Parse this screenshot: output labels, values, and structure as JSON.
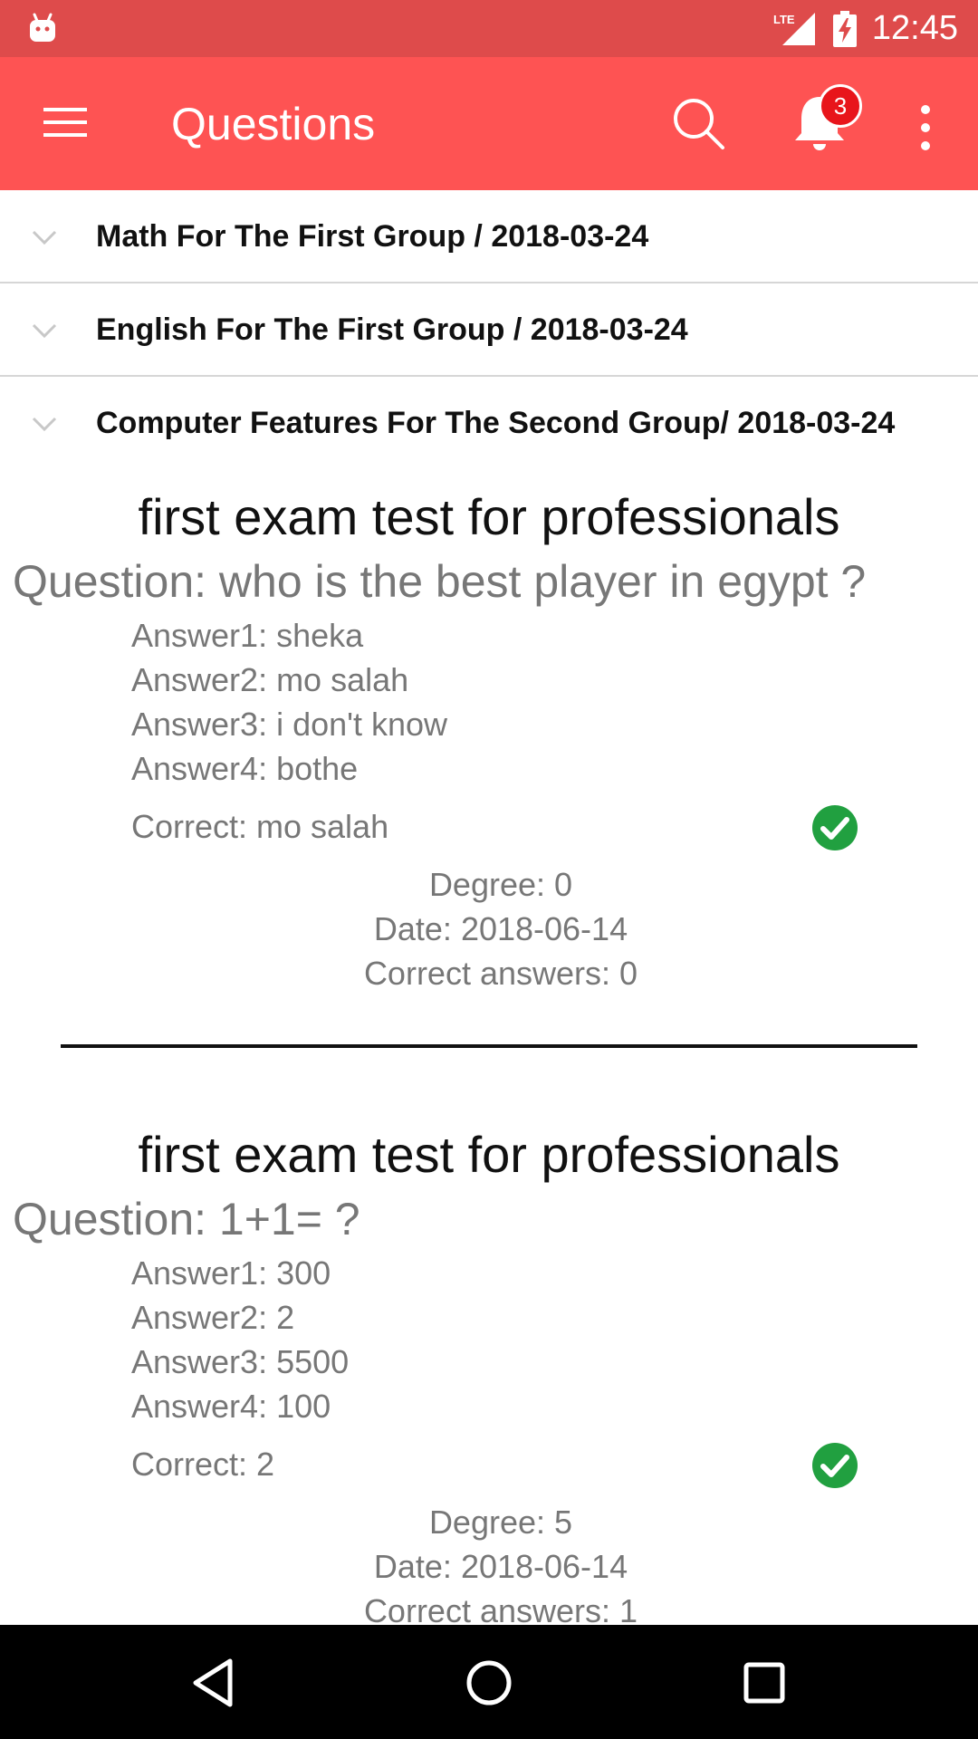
{
  "status_bar": {
    "time": "12:45",
    "network": "LTE",
    "icons": [
      "android-icon",
      "lte-signal-icon",
      "battery-charging-icon"
    ]
  },
  "app_bar": {
    "title": "Questions",
    "notification_count": "3",
    "icons": [
      "menu-icon",
      "search-icon",
      "bell-icon",
      "more-vert-icon"
    ],
    "color": "#fe5353"
  },
  "groups": [
    {
      "label": "Math For The First Group / 2018-03-24"
    },
    {
      "label": "English For The First Group / 2018-03-24"
    },
    {
      "label": "Computer Features For The Second Group/ 2018-03-24"
    }
  ],
  "questions": [
    {
      "exam_title": "first exam test for professionals",
      "question": "Question: who is the best player in egypt ?",
      "answers": [
        "Answer1: sheka",
        "Answer2: mo salah",
        "Answer3: i don't know",
        "Answer4: bothe"
      ],
      "correct": "Correct: mo salah",
      "degree": "Degree: 0",
      "date": "Date: 2018-06-14",
      "correct_answers": "Correct answers: 0"
    },
    {
      "exam_title": "first exam test for professionals",
      "question": "Question: 1+1= ?",
      "answers": [
        "Answer1: 300",
        "Answer2: 2",
        "Answer3: 5500",
        "Answer4: 100"
      ],
      "correct": "Correct: 2",
      "degree": "Degree: 5",
      "date": "Date: 2018-06-14",
      "correct_answers": "Correct answers: 1"
    }
  ],
  "colors": {
    "status_bar": "#de4b4b",
    "check": "#21a040"
  }
}
